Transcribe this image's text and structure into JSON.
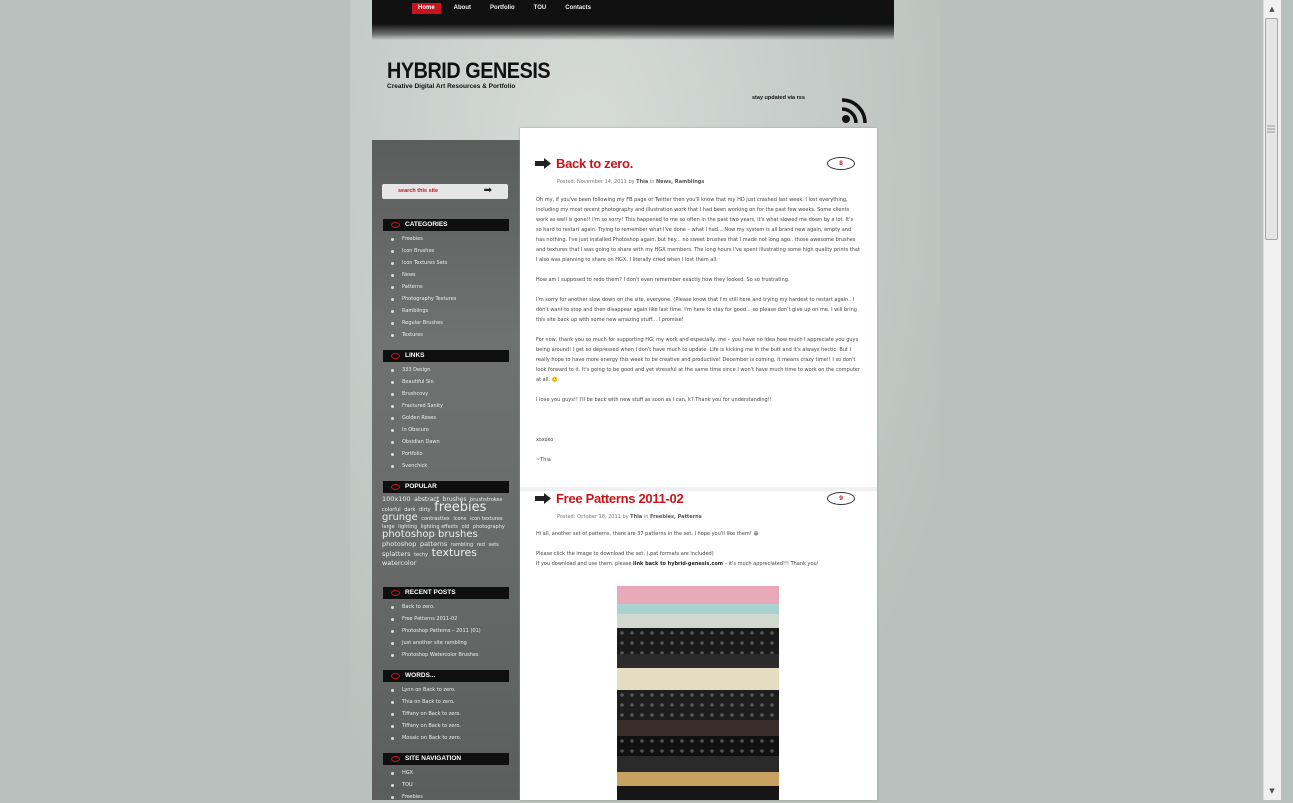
{
  "nav": [
    "Home",
    "About",
    "Portfolio",
    "TOU",
    "Contacts"
  ],
  "site": {
    "title": "HYBRID GENESIS",
    "tagline": "Creative Digital Art Resources & Portfolio",
    "rss": "stay updated via rss"
  },
  "search": {
    "placeholder": "search this site"
  },
  "sidebar": {
    "categories": {
      "title": "CATEGORIES",
      "items": [
        "Freebies",
        "Icon Brushes",
        "Icon Textures Sets",
        "News",
        "Patterns",
        "Photography Textures",
        "Ramblings",
        "Regular Brushes",
        "Textures"
      ]
    },
    "links": {
      "title": "LINKS",
      "items": [
        "333 Design",
        "Beautiful Sin",
        "Brushcovy",
        "Fractured Sanity",
        "Golden Roses",
        "In Obscuro",
        "Obsidian Dawn",
        "Portfolio",
        "Svenchick"
      ]
    },
    "popular": {
      "title": "POPULAR",
      "tags": [
        {
          "t": "100x100",
          "s": 6.5
        },
        {
          "t": "abstract",
          "s": 6
        },
        {
          "t": "brushes",
          "s": 6
        },
        {
          "t": "brushstrokes",
          "s": 5
        },
        {
          "t": "colorful",
          "s": 5
        },
        {
          "t": "dark",
          "s": 5
        },
        {
          "t": "dirty",
          "s": 5
        },
        {
          "t": "freebies",
          "s": 13
        },
        {
          "t": "grunge",
          "s": 10
        },
        {
          "t": "contrasttex",
          "s": 5
        },
        {
          "t": "icons",
          "s": 5
        },
        {
          "t": "icon textures",
          "s": 5
        },
        {
          "t": "large",
          "s": 5
        },
        {
          "t": "lighting",
          "s": 5
        },
        {
          "t": "lighting effects",
          "s": 5
        },
        {
          "t": "old",
          "s": 5
        },
        {
          "t": "photography",
          "s": 5
        },
        {
          "t": "photoshop brushes",
          "s": 10
        },
        {
          "t": "photoshop",
          "s": 6.5
        },
        {
          "t": "patterns",
          "s": 6.5
        },
        {
          "t": "rambling",
          "s": 5
        },
        {
          "t": "red",
          "s": 5
        },
        {
          "t": "sets",
          "s": 5
        },
        {
          "t": "splatters",
          "s": 6.5
        },
        {
          "t": "techy",
          "s": 5
        },
        {
          "t": "textures",
          "s": 11
        },
        {
          "t": "watercolor",
          "s": 6.5
        }
      ]
    },
    "recent": {
      "title": "RECENT POSTS",
      "items": [
        "Back to zero.",
        "Free Patterns 2011-02",
        "Photoshop Patterns – 2011 (01)",
        "Just another site rambling",
        "Photoshop Watercolor Brushes"
      ]
    },
    "words": {
      "title": "WORDS...",
      "items": [
        "Lynn on Back to zero.",
        "Thia on Back to zero.",
        "Tiffany on Back to zero.",
        "Tiffany on Back to zero.",
        "Mosaic on Back to zero."
      ]
    },
    "sitenav": {
      "title": "SITE NAVIGATION",
      "items": [
        "HGX",
        "TOU",
        "Freebies"
      ]
    }
  },
  "posts": [
    {
      "title": "Back to zero.",
      "comments": "8",
      "meta": "Posted: November 14, 2011 by",
      "author": "Thia",
      "in": "in",
      "cats": "News, Ramblings",
      "paragraphs": [
        "Oh my, if you've been following my FB page or Twitter then you'll know that my HD just crashed last week. I lost everything, including my most recent photography and illustration work that I had been working on for the past few weeks. Some clients work as well is gone!! I'm so sorry! This happened to me so often in the past two years, it's what slowed me down by a lot. It's so hard to restart again. Trying to remember what I've done – what I had... Now my system is all brand new again, empty and has nothing. I've just installed Photoshop again, but hey... no sweet brushes that I made not long ago.. those awesome brushes and textures that I was going to share with my HGX members. The long hours I've spent illustrating some high quality prints that I also was planning to share on HGX. I literally cried when I lost them all.",
        "How am I supposed to redo them? I don't even remember exactly how they looked. So so frustrating.",
        "I'm sorry for another slow down on the site, everyone. (Please know that I'm still here and trying my hardest to restart again.. I don't want to stop and then disappear again like last time. I'm here to stay for good... so please don't give up on me. I will bring this site back up with some new amazing stuff... I promise!",
        "For now, thank you so much for supporting HG, my work and especially, me – you have no idea how much I appreciate you guys being around! I get so depressed when I don't have much to update. Life is kicking me in the butt and it's always hectic. But I really hope to have more energy this week to be creative and productive! December is coming, it means crazy time!! I so don't look forward to it. It's going to be good and yet stressful at the same time since I won't have much time to work on the computer at all. 🙂",
        "I love you guys!! I'll be back with new stuff as soon as I can, k? Thank you for understanding!!",
        "",
        "xoxoxo",
        "~Thia"
      ]
    },
    {
      "title": "Free Patterns 2011-02",
      "comments": "9",
      "meta": "Posted: October 18, 2011 by",
      "author": "Thia",
      "in": "in",
      "cats": "Freebies, Patterns",
      "p1": "Hi all, another set of patterns, there are 37 patterns in the set. I hope you'll like them! 😀",
      "p2a": "Please click the image to download the set. (.pat formats are included)",
      "p2b": "If you download and use them, please",
      "p2link": "link back to hybrid-genesis.com",
      "p2c": "– it's much appreciated!!! Thank you!"
    }
  ],
  "pattern_colors": [
    "#e8a9b8",
    "#a9d3d0",
    "#d2d7cf",
    "#1a1a1a",
    "#2b2b2b",
    "#e5dcc2",
    "#1e1e1e",
    "#3a2e2a",
    "#111111",
    "#2a2a2a",
    "#c9a262",
    "#161616",
    "#8a6a3a",
    "#1d1d1d"
  ]
}
